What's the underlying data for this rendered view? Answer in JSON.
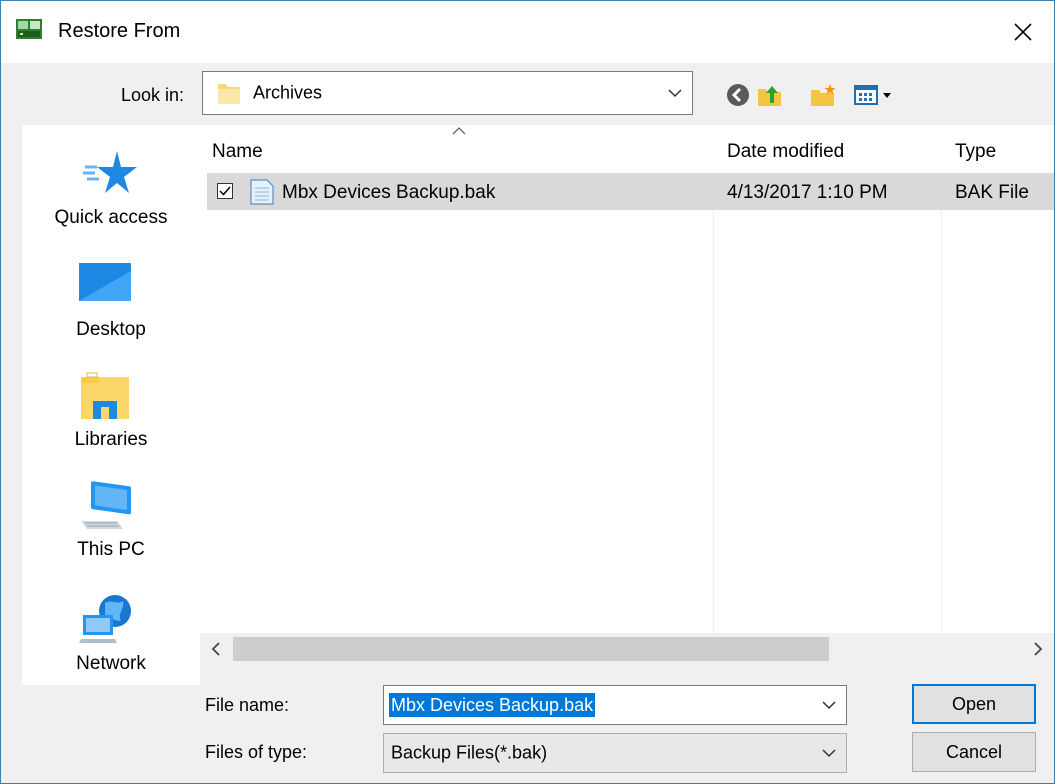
{
  "window": {
    "title": "Restore From"
  },
  "lookin": {
    "label": "Look in:",
    "value": "Archives"
  },
  "toolbar": {
    "back_icon": "back-icon",
    "up_icon": "up-folder-icon",
    "new_folder_icon": "new-folder-icon",
    "view_menu_icon": "view-menu-icon"
  },
  "places": [
    {
      "label": "Quick access",
      "icon": "star-icon"
    },
    {
      "label": "Desktop",
      "icon": "desktop-icon"
    },
    {
      "label": "Libraries",
      "icon": "libraries-icon"
    },
    {
      "label": "This PC",
      "icon": "computer-icon"
    },
    {
      "label": "Network",
      "icon": "network-icon"
    }
  ],
  "columns": {
    "name": "Name",
    "date": "Date modified",
    "type": "Type"
  },
  "files": [
    {
      "name": "Mbx Devices Backup.bak",
      "date": "4/13/2017 1:10 PM",
      "type": "BAK File",
      "selected": true
    }
  ],
  "form": {
    "filename_label": "File name:",
    "filename_value": "Mbx Devices Backup.bak",
    "filetype_label": "Files of type:",
    "filetype_value": "Backup Files(*.bak)"
  },
  "buttons": {
    "open": "Open",
    "cancel": "Cancel"
  },
  "colors": {
    "accent": "#0078d7",
    "selection_row": "#d9d9d9",
    "window_border": "#3c7fb1"
  }
}
